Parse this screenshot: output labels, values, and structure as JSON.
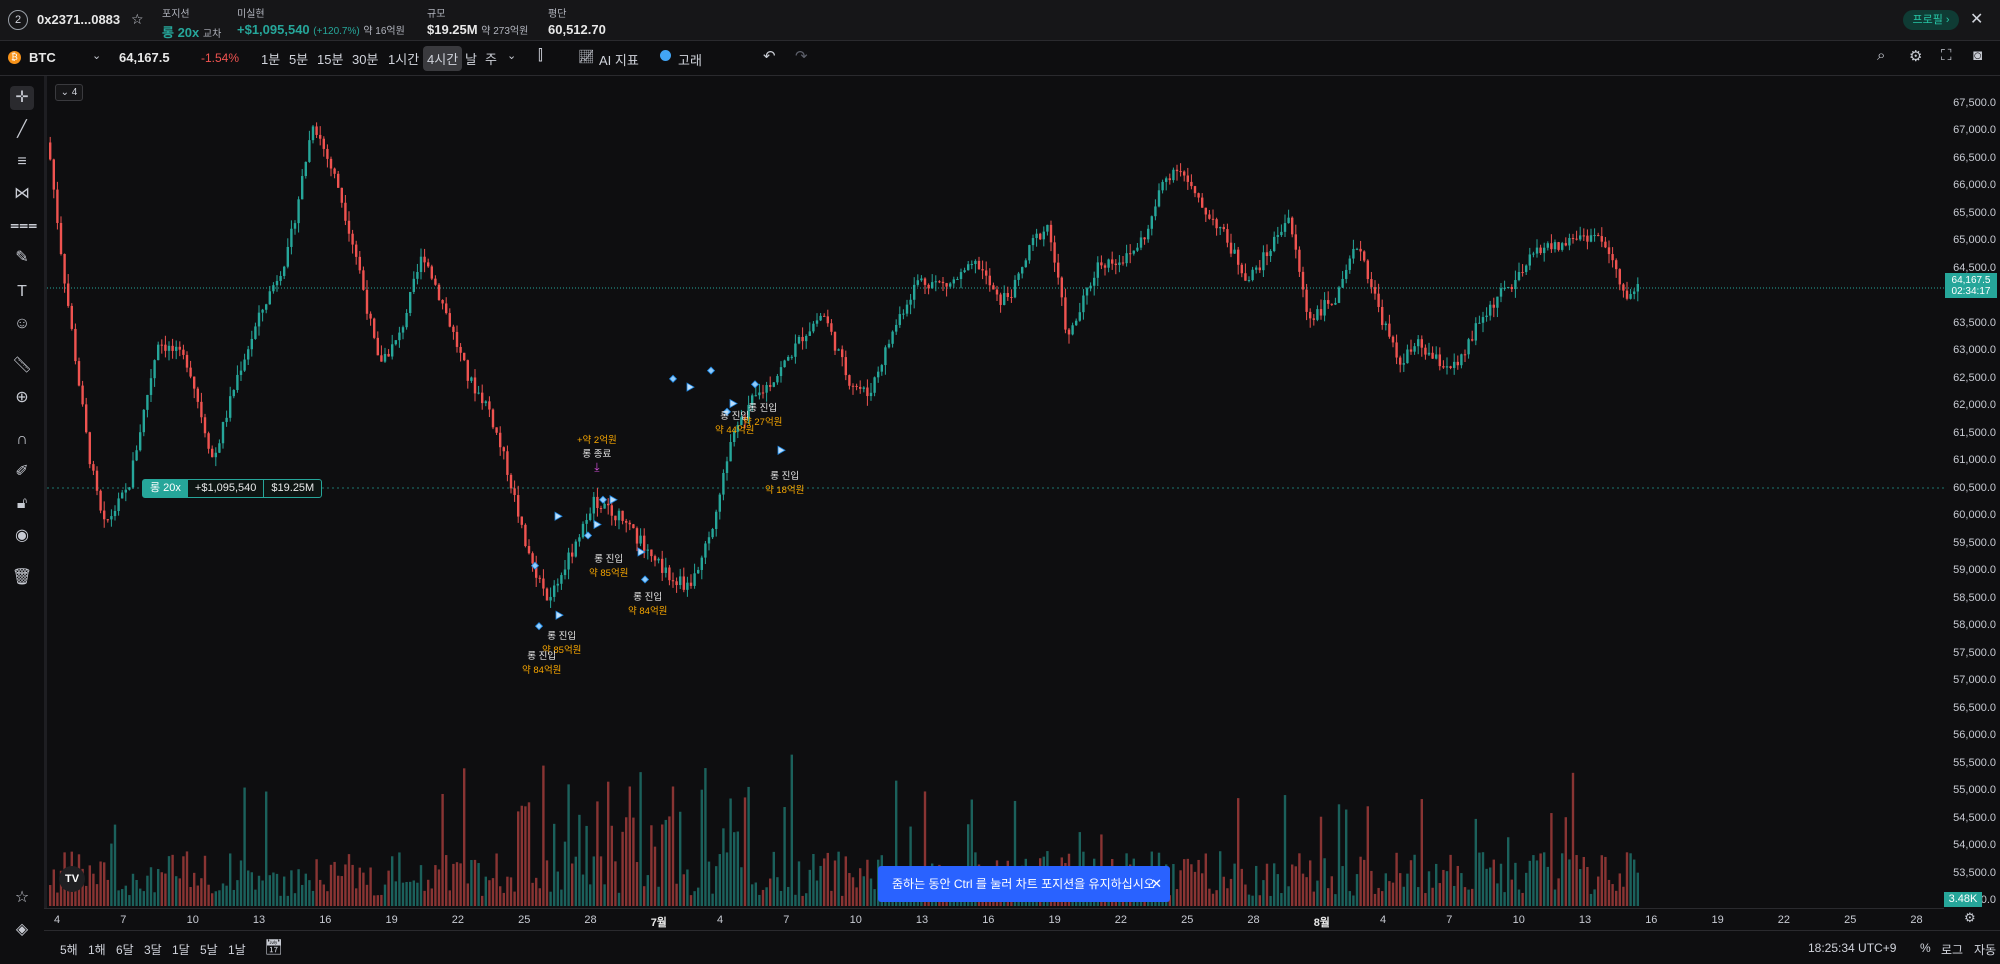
{
  "header": {
    "badge": "2",
    "account": "0x2371...0883",
    "position_label": "포지션",
    "position_value": "롱 20x",
    "position_mode": "교차",
    "pnl_label": "미실현",
    "pnl_value": "+$1,095,540",
    "pnl_pct": "(+120.7%)",
    "pnl_krw": "약 16억원",
    "size_label": "규모",
    "size_value": "$19.25M",
    "size_krw": "약 273억원",
    "avg_label": "평단",
    "avg_value": "60,512.70",
    "profile_label": "프로필 ›",
    "close_icon": "close-icon"
  },
  "toolbar": {
    "symbol": "BTC",
    "price": "64,167.5",
    "change": "-1.54%",
    "timeframes": [
      "1분",
      "5분",
      "15분",
      "30분",
      "1시간",
      "4시간",
      "날",
      "주"
    ],
    "active_timeframe": "4시간",
    "indicator_label": "AI 지표",
    "whale_label": "고래"
  },
  "chart": {
    "collapse_label": "4",
    "position_tag": {
      "side": "롱 20x",
      "pnl": "+$1,095,540",
      "size": "$19.25M"
    },
    "current_price": "64,167.5",
    "countdown": "02:34:17",
    "volume_tag": "3.48K",
    "price_ticks": [
      "67,500.0",
      "67,000.0",
      "66,500.0",
      "66,000.0",
      "65,500.0",
      "65,000.0",
      "64,500.0",
      "63,500.0",
      "63,000.0",
      "62,500.0",
      "62,000.0",
      "61,500.0",
      "61,000.0",
      "60,500.0",
      "60,000.0",
      "59,500.0",
      "59,000.0",
      "58,500.0",
      "58,000.0",
      "57,500.0",
      "57,000.0",
      "56,500.0",
      "56,000.0",
      "55,500.0",
      "55,000.0",
      "54,500.0",
      "54,000.0",
      "53,500.0",
      "53,000.0"
    ],
    "time_ticks": [
      "4",
      "7",
      "10",
      "13",
      "16",
      "19",
      "22",
      "25",
      "28",
      "7월",
      "4",
      "7",
      "10",
      "13",
      "16",
      "19",
      "22",
      "25",
      "28",
      "8월",
      "4",
      "7",
      "10",
      "13",
      "16",
      "19",
      "22",
      "25",
      "28"
    ],
    "annotations": [
      {
        "l1": "+약 2억원",
        "l2": "롱 종료"
      },
      {
        "l1": "롱 진입",
        "l2": "약 44억원"
      },
      {
        "l1": "롱 진입",
        "l2": "약 27억원"
      },
      {
        "l1": "롱 진입",
        "l2": "약 18억원"
      },
      {
        "l1": "롱 진입",
        "l2": "약 85억원"
      },
      {
        "l1": "롱 진입",
        "l2": "약 84억원"
      },
      {
        "l1": "롱 진입",
        "l2": "약 85억원"
      },
      {
        "l1": "롱 진입",
        "l2": "약 84억원"
      }
    ],
    "toast": "줌하는 동안 Ctrl 를 눌러 차트 포지션을 유지하십시오"
  },
  "bottom": {
    "ranges": [
      "5해",
      "1해",
      "6달",
      "3달",
      "1달",
      "5날",
      "1날"
    ],
    "clock": "18:25:34 UTC+9",
    "percent": "%",
    "log": "로그",
    "auto": "자동"
  },
  "colors": {
    "up": "#26a69a",
    "down": "#ef5350",
    "accent": "#2962ff"
  }
}
